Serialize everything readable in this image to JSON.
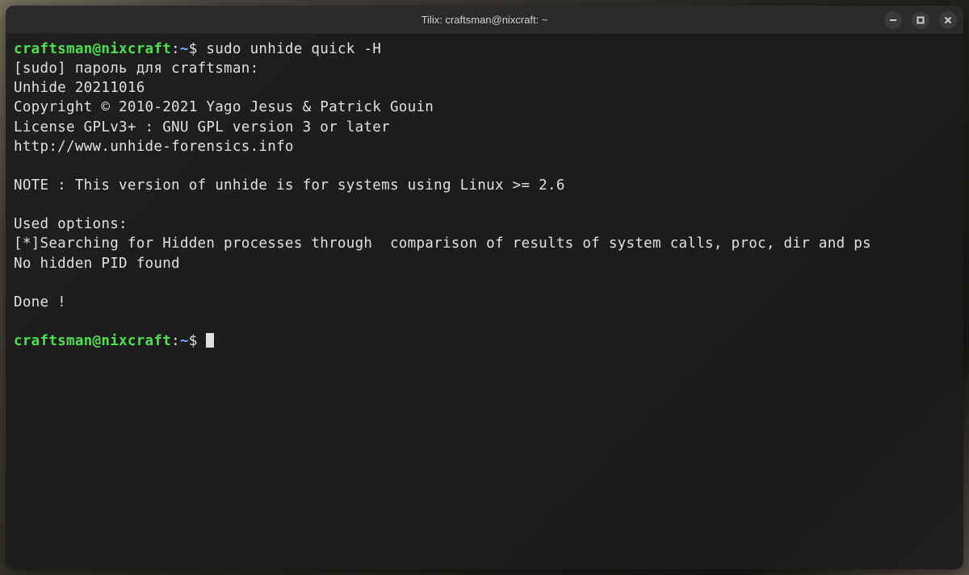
{
  "window": {
    "title": "Tilix: craftsman@nixcraft: ~"
  },
  "terminal": {
    "prompt1": {
      "user_host": "craftsman@nixcraft",
      "separator": ":",
      "path": "~",
      "dollar": "$ ",
      "command": "sudo unhide quick -H"
    },
    "lines": {
      "sudo_pw": "[sudo] пароль для craftsman: ",
      "version": "Unhide 20211016",
      "copyright": "Copyright © 2010-2021 Yago Jesus & Patrick Gouin",
      "license": "License GPLv3+ : GNU GPL version 3 or later",
      "url": "http://www.unhide-forensics.info",
      "blank1": "",
      "note": "NOTE : This version of unhide is for systems using Linux >= 2.6",
      "blank2": "",
      "used_opts": "Used options: ",
      "searching": "[*]Searching for Hidden processes through  comparison of results of system calls, proc, dir and ps",
      "no_hidden": "No hidden PID found",
      "blank3": "",
      "done": "Done !",
      "blank4": ""
    },
    "prompt2": {
      "user_host": "craftsman@nixcraft",
      "separator": ":",
      "path": "~",
      "dollar": "$ "
    }
  }
}
